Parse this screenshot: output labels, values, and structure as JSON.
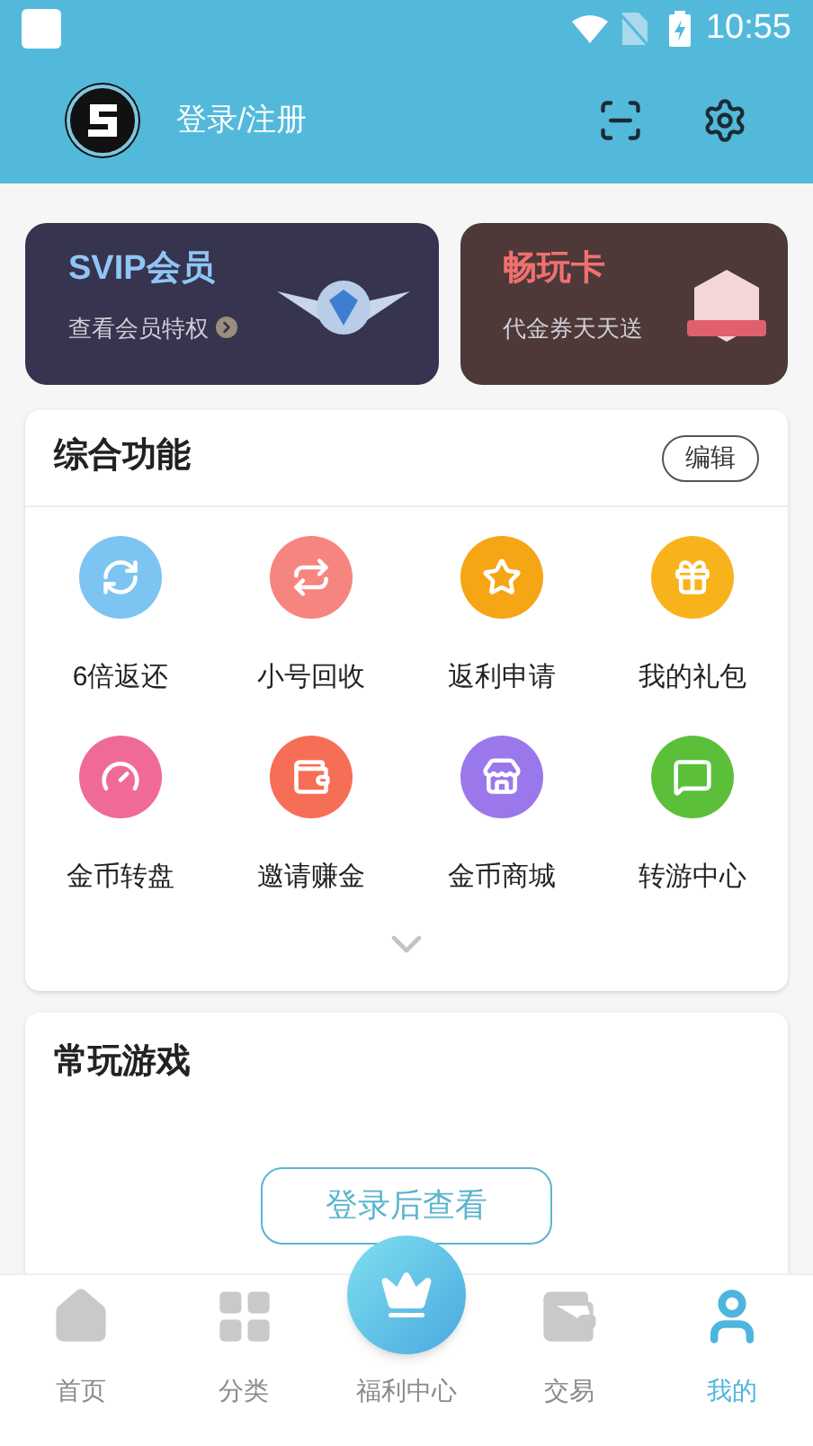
{
  "status_bar": {
    "time": "10:55"
  },
  "header": {
    "login_label": "登录/注册"
  },
  "promo_cards": [
    {
      "kind": "svip",
      "title": "SVIP会员",
      "subtitle": "查看会员特权"
    },
    {
      "kind": "play",
      "title": "畅玩卡",
      "subtitle": "代金券天天送"
    }
  ],
  "features": {
    "title": "综合功能",
    "edit_button": "编辑",
    "items": [
      {
        "label": "6倍返还",
        "color": "#7cc4f2"
      },
      {
        "label": "小号回收",
        "color": "#f7857f"
      },
      {
        "label": "返利申请",
        "color": "#f6a515"
      },
      {
        "label": "我的礼包",
        "color": "#f8b31c"
      },
      {
        "label": "金币转盘",
        "color": "#f06a98"
      },
      {
        "label": "邀请赚金",
        "color": "#f76e57"
      },
      {
        "label": "金币商城",
        "color": "#9a78ec"
      },
      {
        "label": "转游中心",
        "color": "#5bbf3a"
      }
    ]
  },
  "recent_games": {
    "title": "常玩游戏",
    "login_button": "登录后查看"
  },
  "bottom_nav": [
    {
      "label": "首页",
      "selected": false
    },
    {
      "label": "分类",
      "selected": false
    },
    {
      "label": "福利中心",
      "selected": false,
      "kind": "center"
    },
    {
      "label": "交易",
      "selected": false
    },
    {
      "label": "我的",
      "selected": true
    }
  ]
}
